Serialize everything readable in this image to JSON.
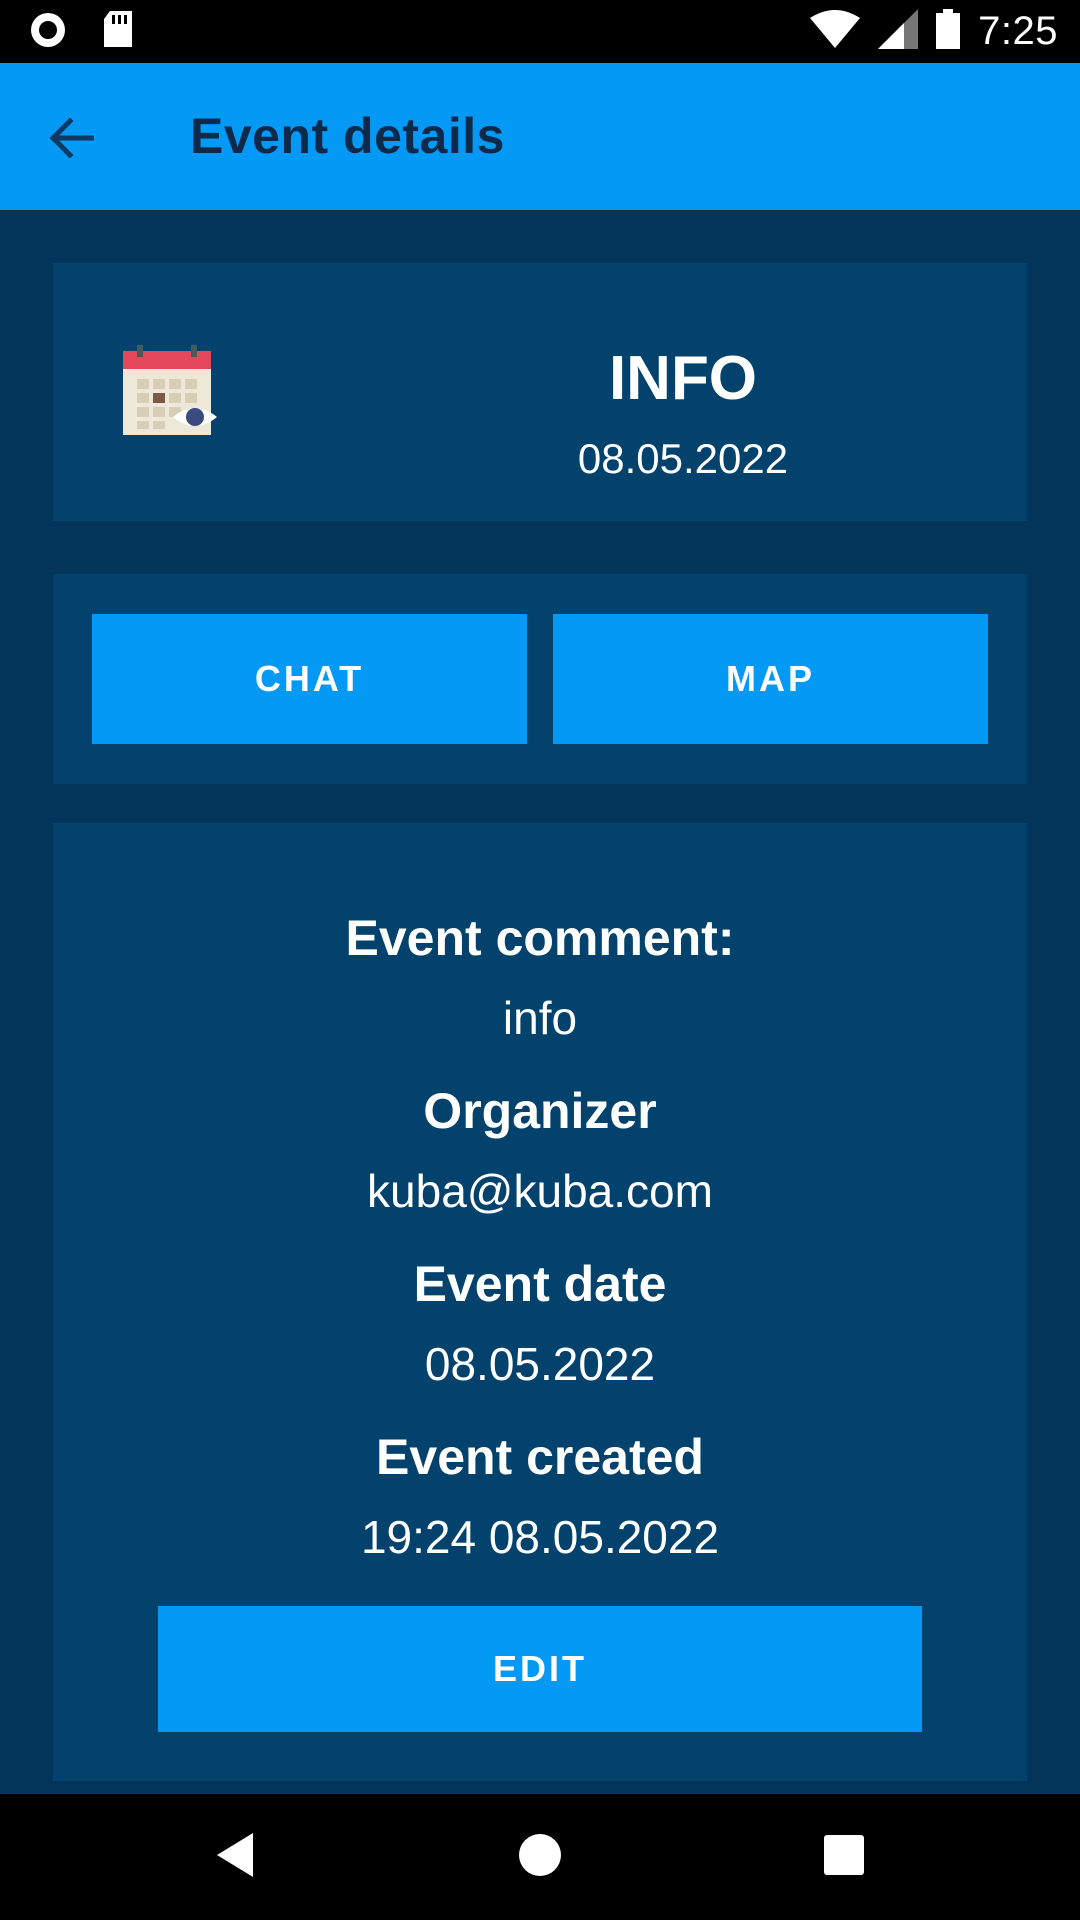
{
  "status_bar": {
    "time": "7:25",
    "icons": [
      "record-icon",
      "sd-card-icon",
      "wifi-icon",
      "signal-icon",
      "battery-icon"
    ]
  },
  "app_bar": {
    "title": "Event details",
    "back_icon": "arrow-left-icon"
  },
  "event_header": {
    "icon": "calendar-eye-icon",
    "title": "INFO",
    "date": "08.05.2022"
  },
  "actions": {
    "chat_label": "CHAT",
    "map_label": "MAP"
  },
  "details": {
    "comment_label": "Event comment:",
    "comment_value": "info",
    "organizer_label": "Organizer",
    "organizer_value": "kuba@kuba.com",
    "date_label": "Event date",
    "date_value": "08.05.2022",
    "created_label": "Event created",
    "created_value": "19:24 08.05.2022",
    "edit_label": "EDIT"
  },
  "nav_bar": {
    "buttons": [
      "back-triangle-icon",
      "home-circle-icon",
      "recents-square-icon"
    ]
  },
  "colors": {
    "app_bar": "#0399f4",
    "background": "#023559",
    "card": "#02426c",
    "button": "#0399f4",
    "title_text": "#0d2a4a"
  }
}
